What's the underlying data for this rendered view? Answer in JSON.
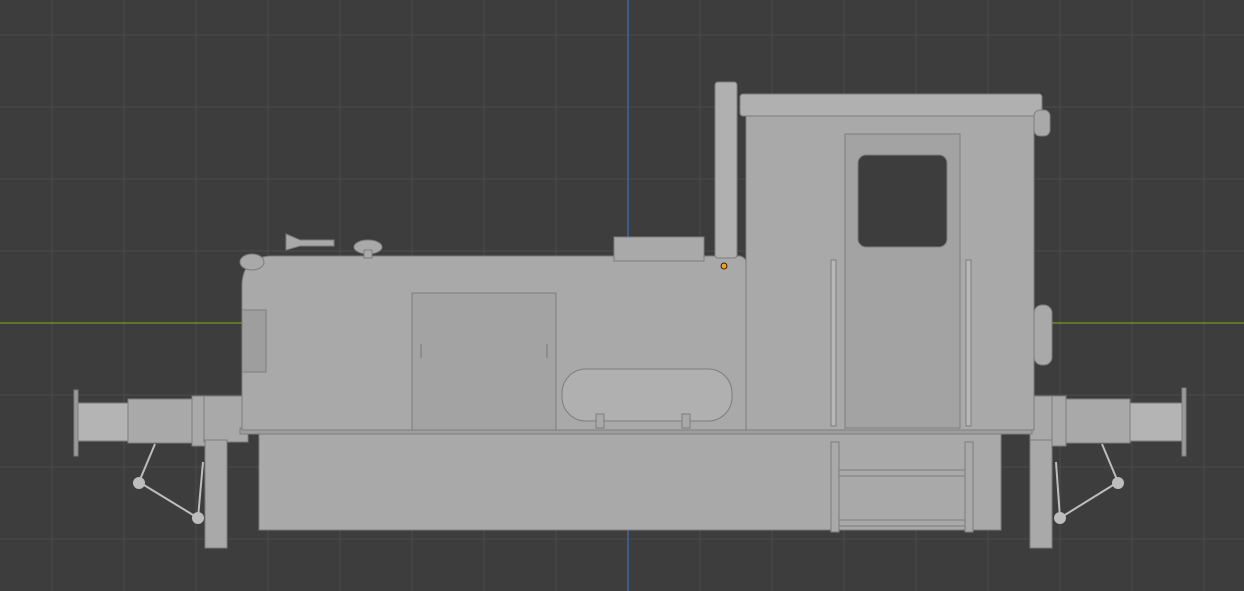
{
  "viewport": {
    "type": "3d-viewport-orthographic-side",
    "background_color": "#3d3d3d",
    "grid_color": "#4a4a4a",
    "x_axis_color": "#6f9a2a",
    "z_axis_color": "#3f6fb8"
  },
  "model": {
    "name_icon": "locomotive-model",
    "body_color": "#a9a9a9",
    "shadow_color": "#8c8c8c",
    "origin_marker_color": "#f0a020"
  }
}
